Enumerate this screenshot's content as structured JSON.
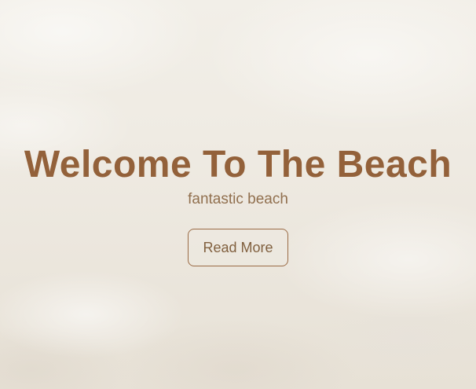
{
  "hero": {
    "title": "Welcome To The Beach",
    "subtitle": "fantastic beach",
    "button_label": "Read More"
  },
  "colors": {
    "title": "#93613a",
    "subtitle": "#91704f",
    "button_border": "#9a6b45",
    "background": "#efebe3"
  }
}
